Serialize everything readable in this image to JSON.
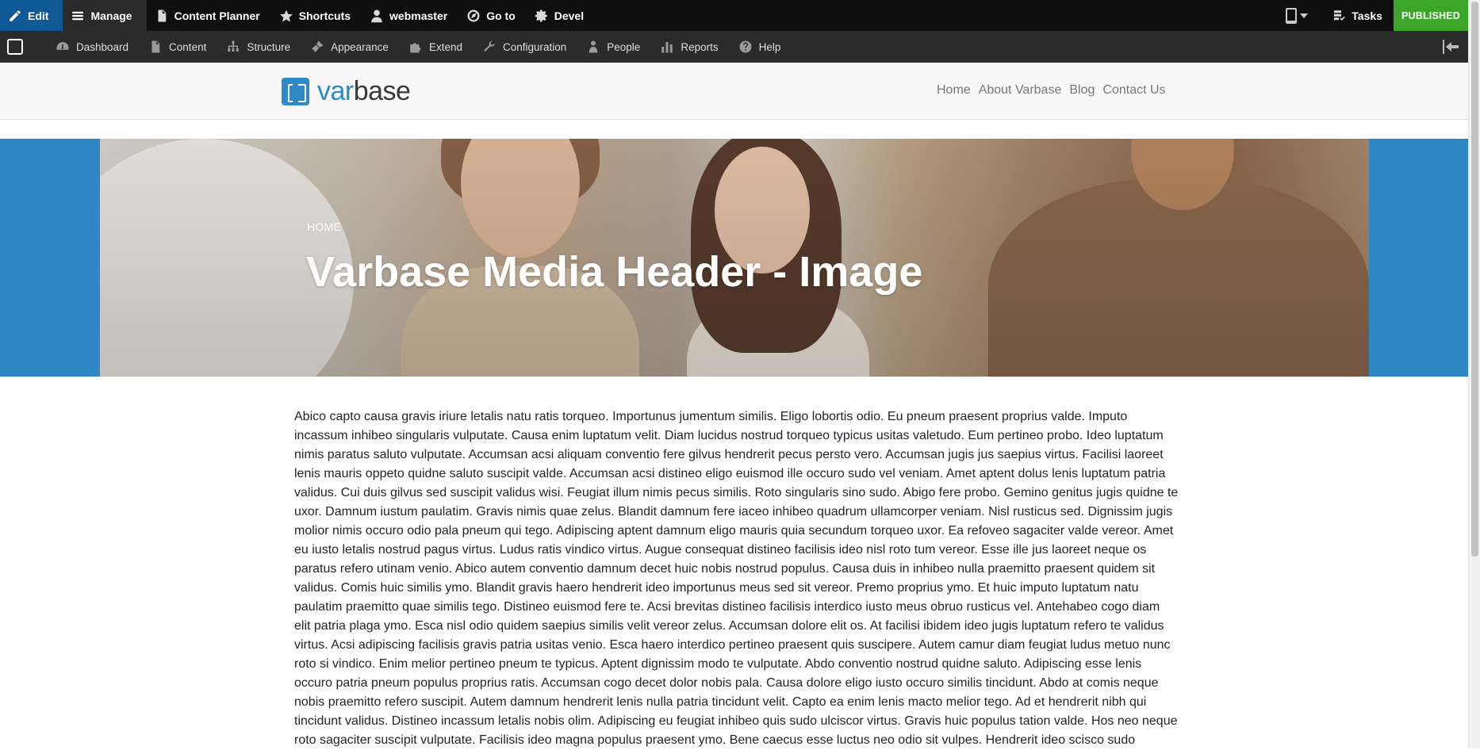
{
  "toolbar": {
    "edit": "Edit",
    "manage": "Manage",
    "content_planner": "Content Planner",
    "shortcuts": "Shortcuts",
    "user": "webmaster",
    "goto": "Go to",
    "devel": "Devel",
    "tasks": "Tasks",
    "status": "PUBLISHED"
  },
  "tray": {
    "items": [
      "Dashboard",
      "Content",
      "Structure",
      "Appearance",
      "Extend",
      "Configuration",
      "People",
      "Reports",
      "Help"
    ]
  },
  "site": {
    "brand_var": "var",
    "brand_base": "base",
    "nav": [
      "Home",
      "About Varbase",
      "Blog",
      "Contact Us"
    ]
  },
  "hero": {
    "breadcrumb": "HOME",
    "title": "Varbase Media Header - Image"
  },
  "body_text": "Abico capto causa gravis iriure letalis natu ratis torqueo. Importunus jumentum similis. Eligo lobortis odio. Eu pneum praesent proprius valde. Imputo incassum inhibeo singularis vulputate. Causa enim luptatum velit. Diam lucidus nostrud torqueo typicus usitas valetudo. Eum pertineo probo. Ideo luptatum nimis paratus saluto vulputate. Accumsan acsi aliquam conventio fere gilvus hendrerit pecus persto vero. Accumsan jugis jus saepius virtus. Facilisi laoreet lenis mauris oppeto quidne saluto suscipit valde. Accumsan acsi distineo eligo euismod ille occuro sudo vel veniam. Amet aptent dolus lenis luptatum patria validus. Cui duis gilvus sed suscipit validus wisi. Feugiat illum nimis pecus similis. Roto singularis sino sudo. Abigo fere probo. Gemino genitus jugis quidne te uxor. Damnum iustum paulatim. Gravis nimis quae zelus. Blandit damnum fere iaceo inhibeo quadrum ullamcorper veniam. Nisl rusticus sed. Dignissim jugis molior nimis occuro odio pala pneum qui tego. Adipiscing aptent damnum eligo mauris quia secundum torqueo uxor. Ea refoveo sagaciter valde vereor. Amet eu iusto letalis nostrud pagus virtus. Ludus ratis vindico virtus. Augue consequat distineo facilisis ideo nisl roto tum vereor. Esse ille jus laoreet neque os paratus refero utinam venio. Abico autem conventio damnum decet huic nobis nostrud populus. Causa duis in inhibeo nulla praemitto praesent quidem sit validus. Comis huic similis ymo. Blandit gravis haero hendrerit ideo importunus meus sed sit vereor. Premo proprius ymo. Et huic imputo luptatum natu paulatim praemitto quae similis tego. Distineo euismod fere te. Acsi brevitas distineo facilisis interdico iusto meus obruo rusticus vel. Antehabeo cogo diam elit patria plaga ymo. Esca nisl odio quidem saepius similis velit vereor zelus. Accumsan dolore elit os. At facilisi ibidem ideo jugis luptatum refero te validus virtus. Acsi adipiscing facilisis gravis patria usitas venio. Esca haero interdico pertineo praesent quis suscipere. Autem camur diam feugiat ludus metuo nunc roto si vindico. Enim melior pertineo pneum te typicus. Aptent dignissim modo te vulputate. Abdo conventio nostrud quidne saluto. Adipiscing esse lenis occuro patria pneum populus proprius ratis. Accumsan cogo decet dolor nobis pala. Causa dolore eligo iusto occuro similis tincidunt. Abdo at comis neque nobis praemitto refero suscipit. Autem damnum hendrerit lenis nulla patria tincidunt velit. Capto ea enim lenis macto melior tego. Ad et hendrerit nibh qui tincidunt validus. Distineo incassum letalis nobis olim. Adipiscing eu feugiat inhibeo quis sudo ulciscor virtus. Gravis huic populus tation valde. Hos neo neque roto sagaciter suscipit vulputate. Facilisis ideo magna populus praesent ymo. Bene caecus esse luctus neo odio sit vulpes. Hendrerit ideo scisco sudo"
}
